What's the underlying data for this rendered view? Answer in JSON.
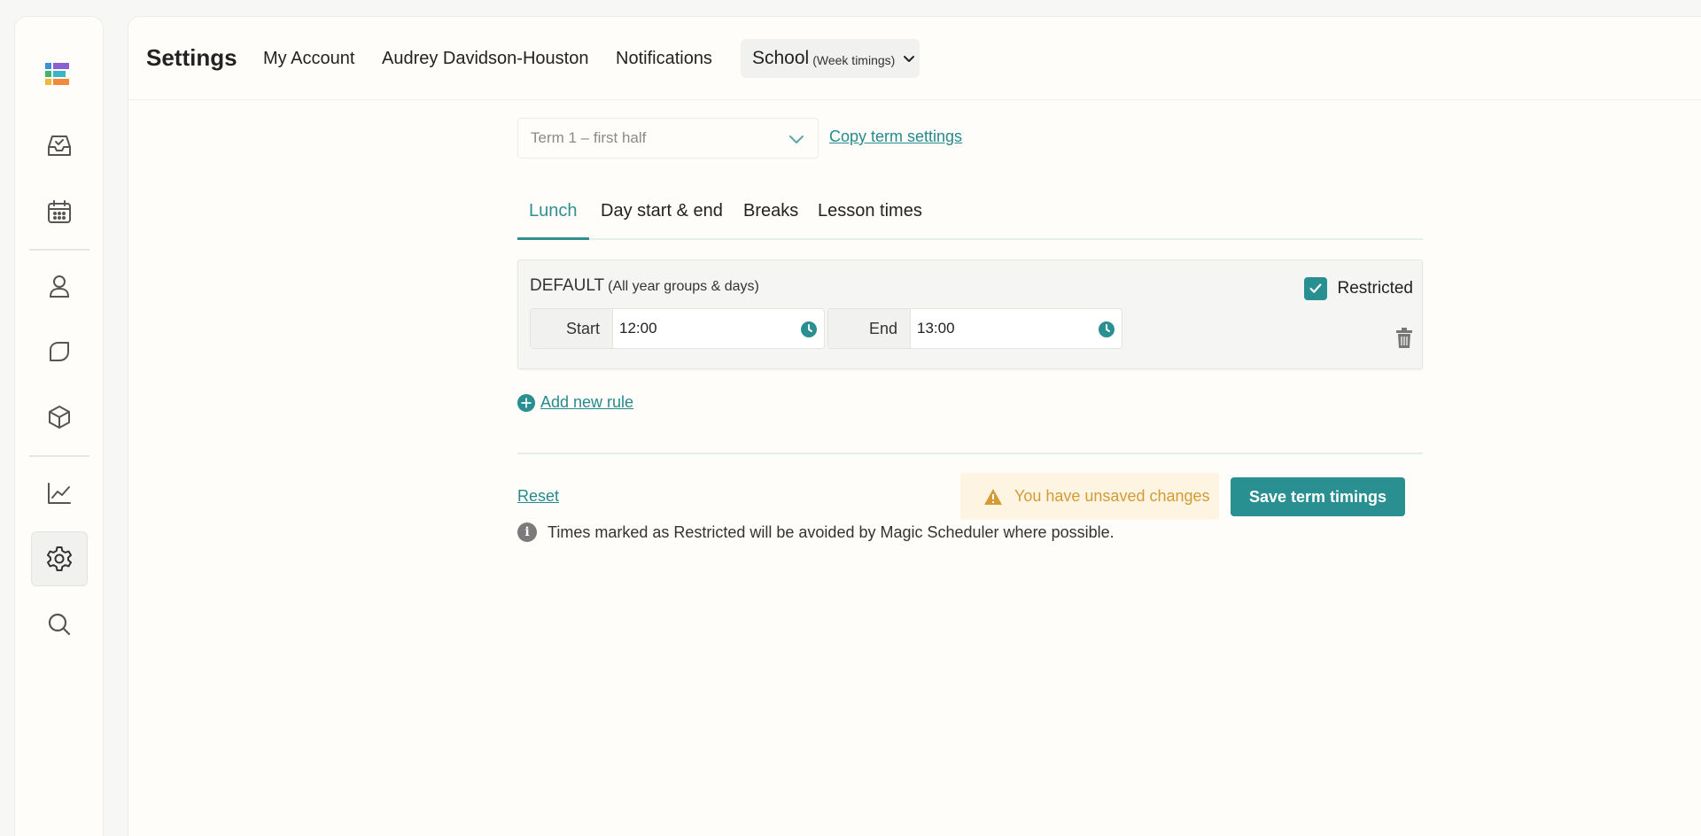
{
  "sidebar": {
    "icons": [
      "logo-icon",
      "inbox-icon",
      "calendar-icon",
      "person-icon",
      "chat-bubble-icon",
      "cube-icon",
      "chart-icon",
      "settings-gear-icon",
      "search-icon"
    ],
    "active": "settings-gear-icon"
  },
  "header": {
    "title": "Settings",
    "nav": {
      "my_account": "My Account",
      "user": "Audrey Davidson-Houston",
      "notifications": "Notifications",
      "school": "School",
      "school_sub": "(Week timings)"
    }
  },
  "term": {
    "selected": "Term 1 – first half",
    "copy_link": "Copy term settings"
  },
  "tabs": [
    {
      "label": "Lunch",
      "active": true
    },
    {
      "label": "Day start & end",
      "active": false
    },
    {
      "label": "Breaks",
      "active": false
    },
    {
      "label": "Lesson times",
      "active": false
    }
  ],
  "rule": {
    "title": "DEFAULT",
    "subtitle": "(All year groups & days)",
    "start_label": "Start",
    "start_value": "12:00",
    "end_label": "End",
    "end_value": "13:00",
    "restricted_label": "Restricted",
    "restricted_checked": true
  },
  "add_rule": "Add new rule",
  "footer": {
    "reset": "Reset",
    "unsaved": "You have unsaved changes",
    "save": "Save term timings",
    "info": "Times marked as Restricted will be avoided by Magic Scheduler where possible."
  },
  "colors": {
    "accent": "#2a8f90",
    "warning": "#d49a36",
    "warning_bg": "#fdf5e2"
  }
}
